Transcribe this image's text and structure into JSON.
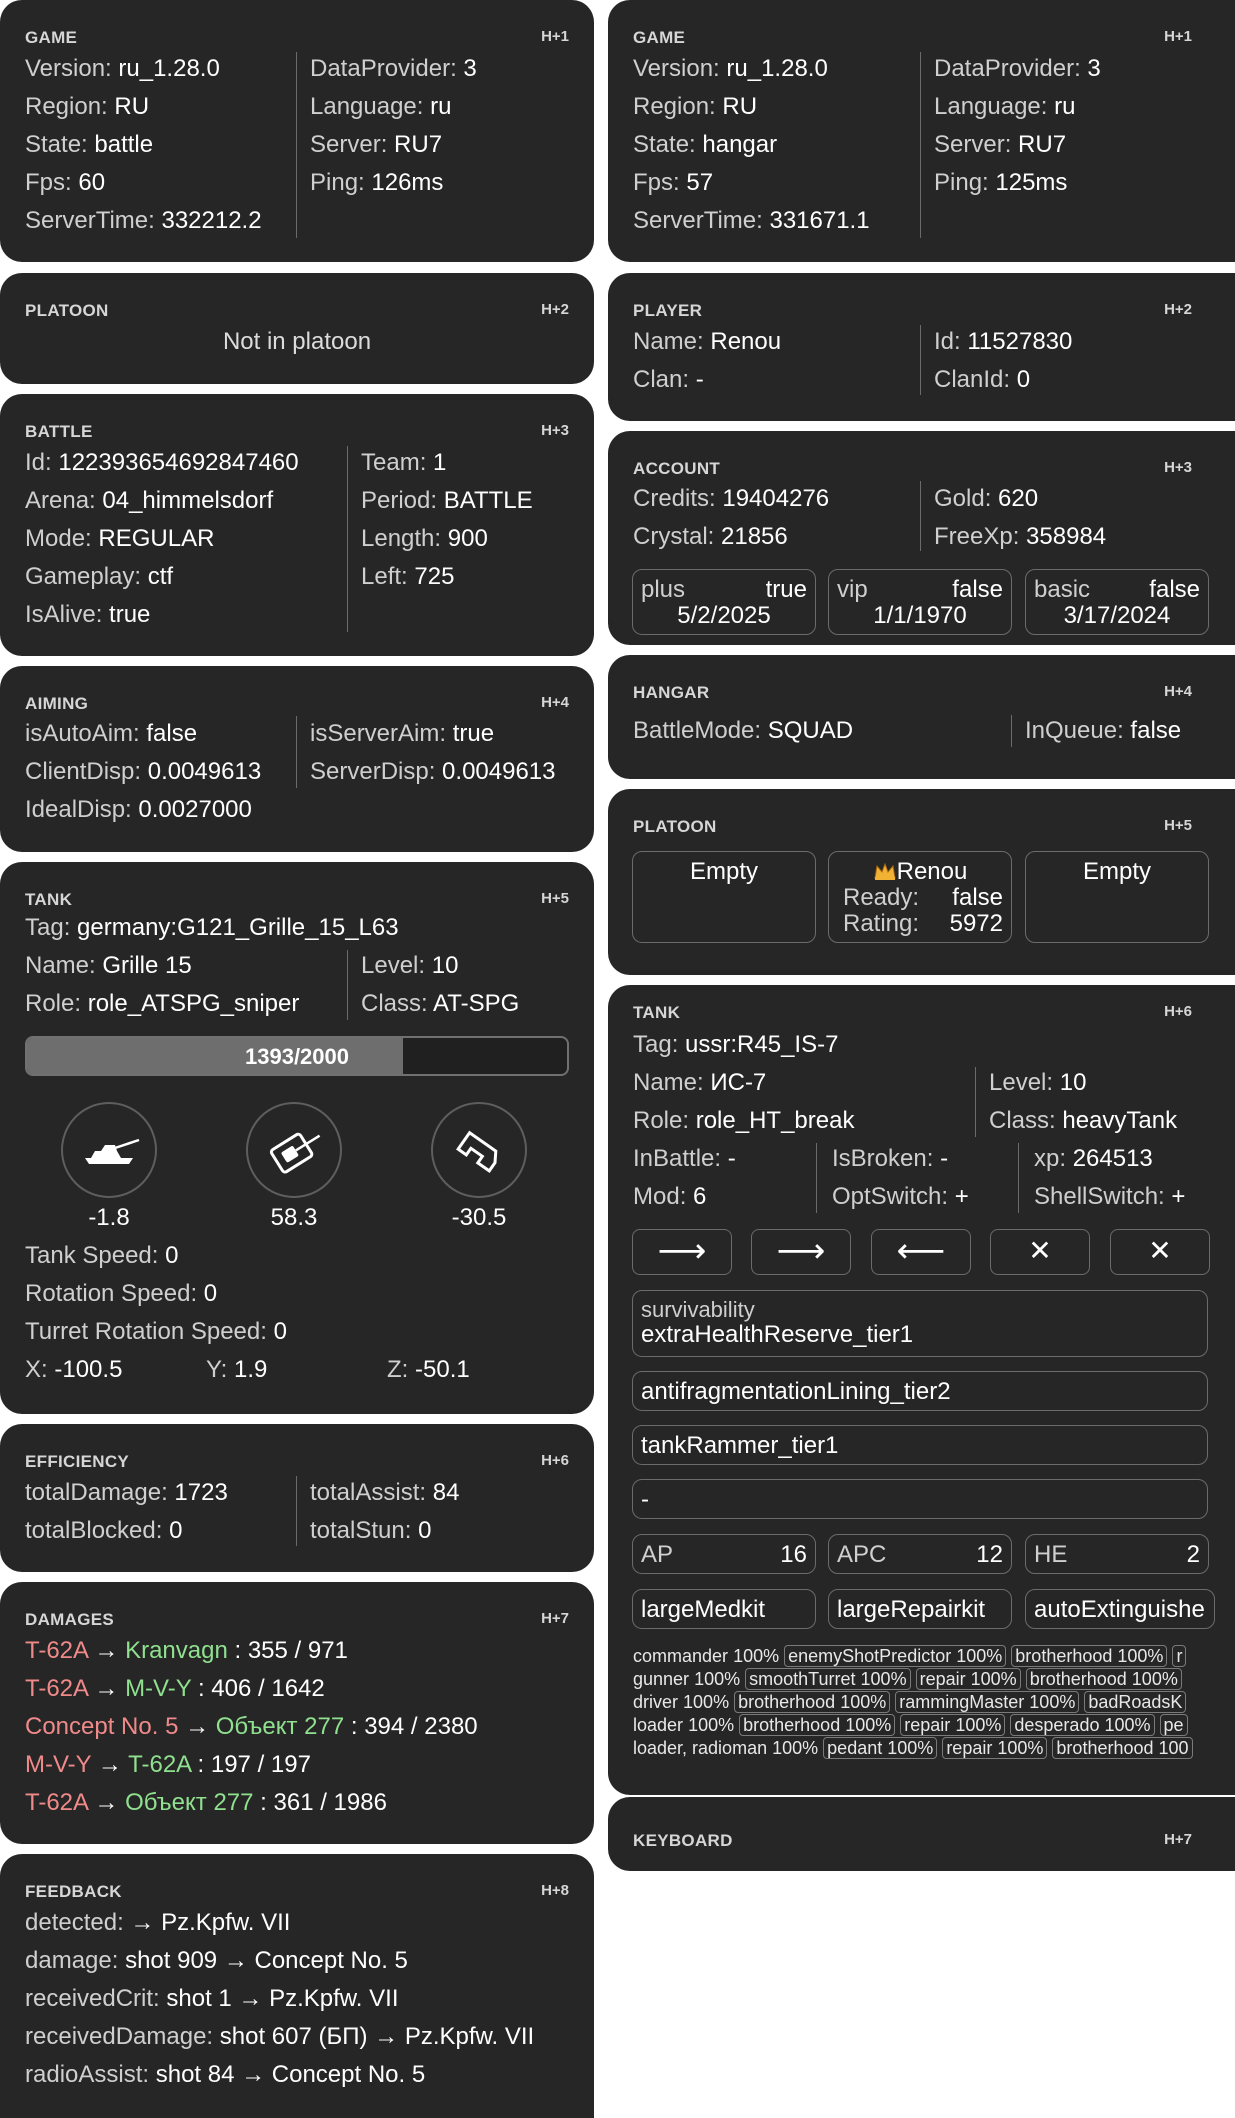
{
  "left": {
    "game": {
      "title": "GAME",
      "hotkey": "H+1",
      "version_k": "Version:",
      "version": "ru_1.28.0",
      "region_k": "Region:",
      "region": "RU",
      "state_k": "State:",
      "state": "battle",
      "fps_k": "Fps:",
      "fps": "60",
      "servertime_k": "ServerTime:",
      "servertime": "332212.2",
      "dataprovider_k": "DataProvider:",
      "dataprovider": "3",
      "language_k": "Language:",
      "language": "ru",
      "server_k": "Server:",
      "server": "RU7",
      "ping_k": "Ping:",
      "ping": "126ms"
    },
    "platoon": {
      "title": "PLATOON",
      "hotkey": "H+2",
      "status": "Not in platoon"
    },
    "battle": {
      "title": "BATTLE",
      "hotkey": "H+3",
      "id_k": "Id:",
      "id": "122393654692847460",
      "arena_k": "Arena:",
      "arena": "04_himmelsdorf",
      "mode_k": "Mode:",
      "mode": "REGULAR",
      "gameplay_k": "Gameplay:",
      "gameplay": "ctf",
      "isalive_k": "IsAlive:",
      "isalive": "true",
      "team_k": "Team:",
      "team": "1",
      "period_k": "Period:",
      "period": "BATTLE",
      "length_k": "Length:",
      "length": "900",
      "left_k": "Left:",
      "left": "725"
    },
    "aiming": {
      "title": "AIMING",
      "hotkey": "H+4",
      "isautoaim_k": "isAutoAim:",
      "isautoaim": "false",
      "clientdisp_k": "ClientDisp:",
      "clientdisp": "0.0049613",
      "idealdisp_k": "IdealDisp:",
      "idealdisp": "0.0027000",
      "isserveraim_k": "isServerAim:",
      "isserveraim": "true",
      "serverdisp_k": "ServerDisp:",
      "serverdisp": "0.0049613"
    },
    "tank": {
      "title": "TANK",
      "hotkey": "H+5",
      "tag_k": "Tag:",
      "tag": "germany:G121_Grille_15_L63",
      "name_k": "Name:",
      "name": "Grille 15",
      "role_k": "Role:",
      "role": "role_ATSPG_sniper",
      "level_k": "Level:",
      "level": "10",
      "class_k": "Class:",
      "class": "AT-SPG",
      "health_text": "1393/2000",
      "health_current": 1393,
      "health_max": 2000,
      "angle_hull": "-1.8",
      "angle_turret": "58.3",
      "angle_gun": "-30.5",
      "tankspeed_k": "Tank Speed:",
      "tankspeed": "0",
      "rotspeed_k": "Rotation Speed:",
      "rotspeed": "0",
      "turretrot_k": "Turret Rotation Speed:",
      "turretrot": "0",
      "x_k": "X:",
      "x": "-100.5",
      "y_k": "Y:",
      "y": "1.9",
      "z_k": "Z:",
      "z": "-50.1",
      "icons": [
        "tank-hull-icon",
        "tank-turret-icon",
        "gun-elevation-icon"
      ]
    },
    "efficiency": {
      "title": "EFFICIENCY",
      "hotkey": "H+6",
      "totaldamage_k": "totalDamage:",
      "totaldamage": "1723",
      "totalblocked_k": "totalBlocked:",
      "totalblocked": "0",
      "totalassist_k": "totalAssist:",
      "totalassist": "84",
      "totalstun_k": "totalStun:",
      "totalstun": "0"
    },
    "damages": {
      "title": "DAMAGES",
      "hotkey": "H+7",
      "rows": [
        {
          "from": "T-62A",
          "to": "Kranvagn",
          "value": " : 355 / 971"
        },
        {
          "from": "T-62A",
          "to": "M-V-Y",
          "value": " : 406 / 1642"
        },
        {
          "from": "Concept No. 5",
          "to": "Объект 277",
          "value": " : 394 / 2380"
        },
        {
          "from": "M-V-Y",
          "to": "T-62A",
          "value": " : 197 / 197"
        },
        {
          "from": "T-62A",
          "to": "Объект 277",
          "value": " : 361 / 1986"
        }
      ],
      "arrow": " → ",
      "colors": {
        "attacker": "#f08a8a",
        "target": "#8fe08f"
      }
    },
    "feedback": {
      "title": "FEEDBACK",
      "hotkey": "H+8",
      "rows": [
        {
          "k": "detected:",
          "v": " → Pz.Kpfw. VII"
        },
        {
          "k": "damage:",
          "v": " shot 909 → Concept No. 5"
        },
        {
          "k": "receivedCrit:",
          "v": " shot 1 → Pz.Kpfw. VII"
        },
        {
          "k": "receivedDamage:",
          "v": " shot 607 (БП) → Pz.Kpfw. VII"
        },
        {
          "k": "radioAssist:",
          "v": " shot 84 → Concept No. 5"
        }
      ]
    }
  },
  "right": {
    "game": {
      "title": "GAME",
      "hotkey": "H+1",
      "version_k": "Version:",
      "version": "ru_1.28.0",
      "region_k": "Region:",
      "region": "RU",
      "state_k": "State:",
      "state": "hangar",
      "fps_k": "Fps:",
      "fps": "57",
      "servertime_k": "ServerTime:",
      "servertime": "331671.1",
      "dataprovider_k": "DataProvider:",
      "dataprovider": "3",
      "language_k": "Language:",
      "language": "ru",
      "server_k": "Server:",
      "server": "RU7",
      "ping_k": "Ping:",
      "ping": "125ms"
    },
    "player": {
      "title": "PLAYER",
      "hotkey": "H+2",
      "name_k": "Name:",
      "name": "Renou",
      "clan_k": "Clan:",
      "clan": "-",
      "id_k": "Id:",
      "id": "11527830",
      "clanid_k": "ClanId:",
      "clanid": "0"
    },
    "account": {
      "title": "ACCOUNT",
      "hotkey": "H+3",
      "credits_k": "Credits:",
      "credits": "19404276",
      "crystal_k": "Crystal:",
      "crystal": "21856",
      "gold_k": "Gold:",
      "gold": "620",
      "freexp_k": "FreeXp:",
      "freexp": "358984",
      "subs": [
        {
          "name": "plus",
          "active": "true",
          "date": "5/2/2025"
        },
        {
          "name": "vip",
          "active": "false",
          "date": "1/1/1970"
        },
        {
          "name": "basic",
          "active": "false",
          "date": "3/17/2024"
        }
      ]
    },
    "hangar": {
      "title": "HANGAR",
      "hotkey": "H+4",
      "battlemode_k": "BattleMode:",
      "battlemode": "SQUAD",
      "inqueue_k": "InQueue:",
      "inqueue": "false"
    },
    "platoon": {
      "title": "PLATOON",
      "hotkey": "H+5",
      "slot1": "Empty",
      "slot2_name": "Renou",
      "slot2_ready_k": "Ready:",
      "slot2_ready": "false",
      "slot2_rating_k": "Rating:",
      "slot2_rating": "5972",
      "slot3": "Empty",
      "leader_icon": "crown-icon"
    },
    "tank": {
      "title": "TANK",
      "hotkey": "H+6",
      "tag_k": "Tag:",
      "tag": "ussr:R45_IS-7",
      "name_k": "Name:",
      "name": "ИС-7",
      "role_k": "Role:",
      "role": "role_HT_break",
      "level_k": "Level:",
      "level": "10",
      "class_k": "Class:",
      "class": "heavyTank",
      "inbattle_k": "InBattle:",
      "inbattle": "-",
      "mod_k": "Mod:",
      "mod": "6",
      "isbroken_k": "IsBroken:",
      "isbroken": "-",
      "optswitch_k": "OptSwitch:",
      "optswitch": "+",
      "xp_k": "xp:",
      "xp": "264513",
      "shellswitch_k": "ShellSwitch:",
      "shellswitch": "+",
      "buttons": [
        "⟶",
        "⟶",
        "⟵",
        "✕",
        "✕"
      ],
      "slot1_label": "survivability",
      "slot1": "extraHealthReserve_tier1",
      "slot2": "antifragmentationLining_tier2",
      "slot3": "tankRammer_tier1",
      "slot4": "-",
      "shells": [
        {
          "name": "AP",
          "count": "16"
        },
        {
          "name": "APC",
          "count": "12"
        },
        {
          "name": "HE",
          "count": "2"
        }
      ],
      "consumables": [
        "largeMedkit",
        "largeRepairkit",
        "autoExtinguishe"
      ],
      "crew": [
        {
          "role": "commander",
          "pct": "100%",
          "skills": [
            [
              "enemyShotPredictor",
              "100%"
            ],
            [
              "brotherhood",
              "100%"
            ],
            [
              "r",
              ""
            ]
          ]
        },
        {
          "role": "gunner",
          "pct": "100%",
          "skills": [
            [
              "smoothTurret",
              "100%"
            ],
            [
              "repair",
              "100%"
            ],
            [
              "brotherhood",
              "100%"
            ]
          ]
        },
        {
          "role": "driver",
          "pct": "100%",
          "skills": [
            [
              "brotherhood",
              "100%"
            ],
            [
              "rammingMaster",
              "100%"
            ],
            [
              "badRoadsK",
              ""
            ]
          ]
        },
        {
          "role": "loader",
          "pct": "100%",
          "skills": [
            [
              "brotherhood",
              "100%"
            ],
            [
              "repair",
              "100%"
            ],
            [
              "desperado",
              "100%"
            ],
            [
              "pe",
              ""
            ]
          ]
        },
        {
          "role": "loader, radioman",
          "pct": "100%",
          "skills": [
            [
              "pedant",
              "100%"
            ],
            [
              "repair",
              "100%"
            ],
            [
              "brotherhood",
              "100"
            ]
          ]
        }
      ]
    },
    "keyboard": {
      "title": "KEYBOARD",
      "hotkey": "H+7"
    }
  }
}
